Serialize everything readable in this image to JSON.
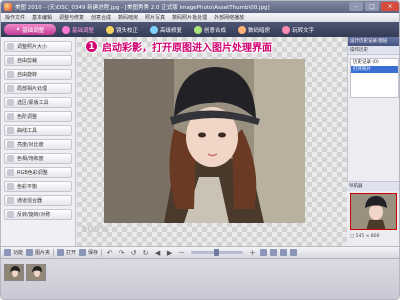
{
  "window": {
    "title": "美图 2010 - (天)DSC_0349 新建进程.jpg - [美图秀秀 2.0 正式版 ImagePhoto\\AssetThumb\\00.jpg]",
    "controls": [
      "–",
      "□",
      "×"
    ]
  },
  "menu": [
    "操作文件",
    "基本编辑",
    "调整与修复",
    "创意合成",
    "数码暗房",
    "照片写真",
    "数码照片批处理",
    "外部网络播放"
  ],
  "tabs": {
    "home_label": "基础调整",
    "items": [
      {
        "label": "基础调整",
        "active": true,
        "icon": "adjust-icon",
        "color": "#ff79d6"
      },
      {
        "label": "镜头校正",
        "active": false,
        "icon": "lens-icon",
        "color": "#f5d25c"
      },
      {
        "label": "高级修复",
        "active": false,
        "icon": "repair-icon",
        "color": "#7fd0ff"
      },
      {
        "label": "创意合成",
        "active": false,
        "icon": "composite-icon",
        "color": "#a7e37a"
      },
      {
        "label": "数码暗房",
        "active": false,
        "icon": "darkroom-icon",
        "color": "#ffb27a"
      },
      {
        "label": "玩转文字",
        "active": false,
        "icon": "text-icon",
        "color": "#ff8ab0"
      }
    ]
  },
  "left_tools": [
    "调整照片大小",
    "自由剪裁",
    "自由旋转",
    "局部相片处理",
    "选区/蒙版工具",
    "色阶调整",
    "曲线工具",
    "亮度/对比度",
    "色相/饱和度",
    "RGB色彩调整",
    "色彩平衡",
    "通道混合器",
    "反转/旋转/对称"
  ],
  "overlay": {
    "step_number": "1",
    "step_text": "启动彩影，打开原图进入图片处理界面",
    "zoom_text": "100%"
  },
  "right_panel": {
    "header": "设计历史记录 图层",
    "subheader": "操作历史",
    "history": [
      {
        "label": "历史记录 (0)",
        "selected": false
      },
      {
        "label": "打开照片",
        "selected": true
      }
    ],
    "navigator_title": "导航器",
    "navigator_info": "□ 545 × 800"
  },
  "status_bar": {
    "items": [
      {
        "label": "功能",
        "icon": "function-icon"
      },
      {
        "label": "图片夹",
        "icon": "folder-icon"
      },
      {
        "label": "打开",
        "icon": "open-icon"
      },
      {
        "label": "保存",
        "icon": "save-icon"
      }
    ],
    "controls": [
      "↶",
      "↷",
      "↺",
      "↻",
      "◀",
      "▶"
    ],
    "zoom_minus": "－",
    "zoom_plus": "＋",
    "zoom_level": 0.48,
    "bottom_icons": [
      "fit-icon",
      "actual-size-icon",
      "fullscreen-icon",
      "compare-icon"
    ]
  },
  "filmstrip": {
    "thumb_count": 2
  }
}
